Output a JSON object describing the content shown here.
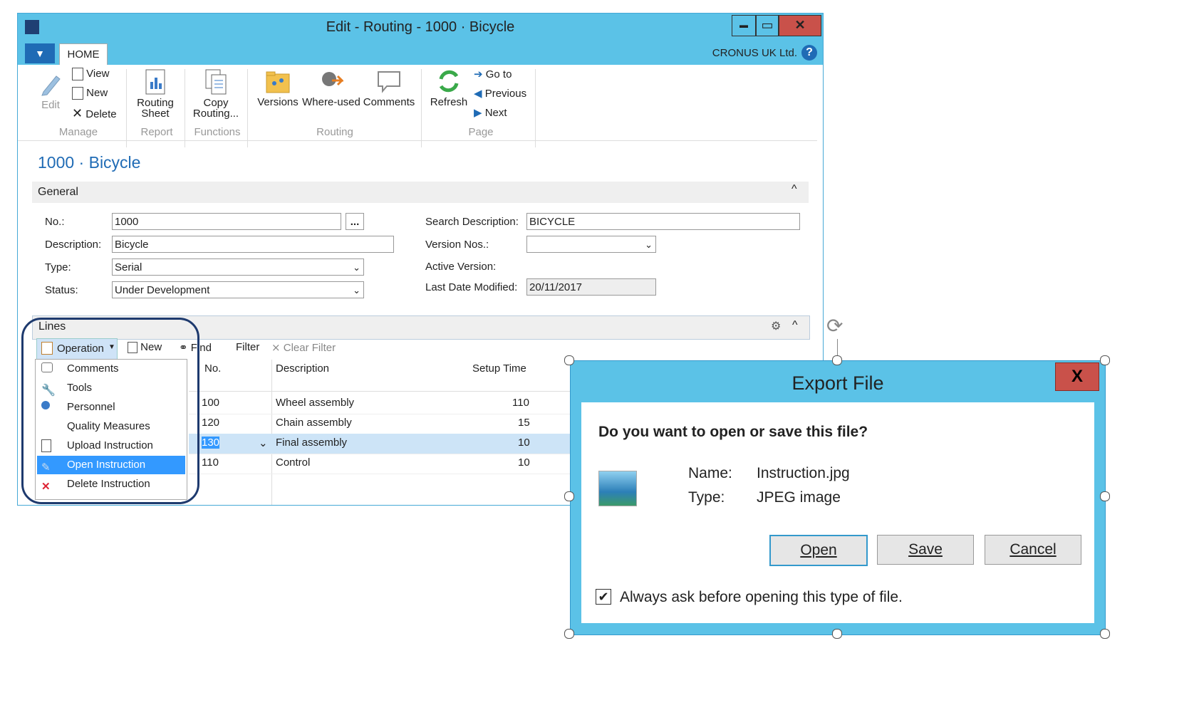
{
  "window": {
    "title": "Edit - Routing - 1000 · Bicycle",
    "minimize": "▬",
    "maximize": "▭",
    "close": "✕"
  },
  "ribbon": {
    "tab_home": "HOME",
    "company": "CRONUS UK Ltd.",
    "help": "?",
    "manage": {
      "edit": "Edit",
      "view": "View",
      "new": "New",
      "delete": "Delete",
      "group": "Manage"
    },
    "report": {
      "routing_sheet_1": "Routing",
      "routing_sheet_2": "Sheet",
      "group": "Report"
    },
    "functions": {
      "copy_1": "Copy",
      "copy_2": "Routing...",
      "group": "Functions"
    },
    "routing": {
      "versions": "Versions",
      "where_used": "Where-used",
      "comments": "Comments",
      "group": "Routing"
    },
    "page": {
      "refresh": "Refresh",
      "goto": "Go to",
      "previous": "Previous",
      "next": "Next",
      "group": "Page"
    }
  },
  "page_title": "1000 · Bicycle",
  "general": {
    "header": "General",
    "no_label": "No.:",
    "no_value": "1000",
    "assist": "...",
    "description_label": "Description:",
    "description_value": "Bicycle",
    "type_label": "Type:",
    "type_value": "Serial",
    "status_label": "Status:",
    "status_value": "Under Development",
    "search_label": "Search Description:",
    "search_value": "BICYCLE",
    "version_nos_label": "Version Nos.:",
    "version_nos_value": "",
    "active_version_label": "Active Version:",
    "last_modified_label": "Last Date Modified:",
    "last_modified_value": "20/11/2017"
  },
  "lines": {
    "header": "Lines",
    "toolbar": {
      "operation": "Operation",
      "new": "New",
      "find": "Find",
      "filter": "Filter",
      "clear_filter": "Clear Filter"
    },
    "columns": {
      "no": "No.",
      "description": "Description",
      "setup_time": "Setup Time"
    },
    "rows": [
      {
        "no": "100",
        "description": "Wheel assembly",
        "setup_time": "110"
      },
      {
        "no": "120",
        "description": "Chain assembly",
        "setup_time": "15"
      },
      {
        "no": "130",
        "description": "Final assembly",
        "setup_time": "10"
      },
      {
        "no": "110",
        "description": "Control",
        "setup_time": "10"
      }
    ],
    "menu": [
      "Comments",
      "Tools",
      "Personnel",
      "Quality Measures",
      "Upload Instruction",
      "Open Instruction",
      "Delete Instruction"
    ]
  },
  "dialog": {
    "title": "Export File",
    "close": "X",
    "question": "Do you want to open or save this file?",
    "name_label": "Name:",
    "name_value": "Instruction.jpg",
    "type_label": "Type:",
    "type_value": "JPEG image",
    "open": "Open",
    "save": "Save",
    "cancel": "Cancel",
    "always_ask": "Always ask before opening this type of file.",
    "always_ask_checked": true
  },
  "colors": {
    "accent": "#5bc2e7",
    "link_blue": "#1f6bb5",
    "selection": "#3399ff",
    "close_red": "#c9514a"
  }
}
